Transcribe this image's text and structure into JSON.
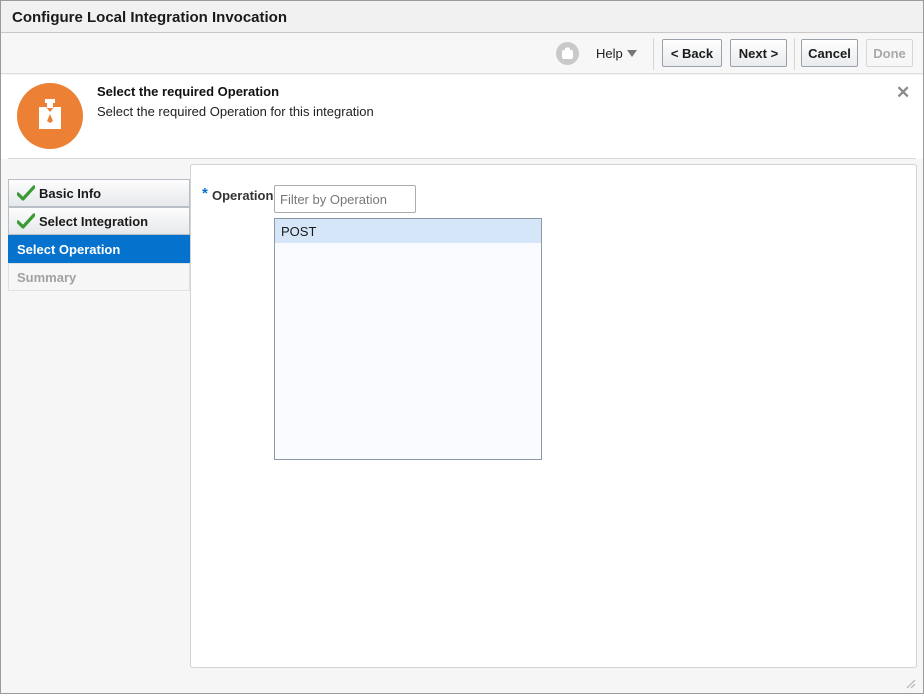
{
  "dialog": {
    "title": "Configure Local Integration Invocation"
  },
  "toolbar": {
    "help_label": "Help",
    "back_label": "< Back",
    "next_label": "Next >",
    "cancel_label": "Cancel",
    "done_label": "Done"
  },
  "header": {
    "title": "Select the required Operation",
    "description": "Select the required Operation for this integration",
    "close_glyph": "✕"
  },
  "nav": {
    "items": [
      {
        "label": "Basic Info",
        "state": "completed"
      },
      {
        "label": "Select Integration",
        "state": "completed"
      },
      {
        "label": "Select Operation",
        "state": "active"
      },
      {
        "label": "Summary",
        "state": "inactive"
      }
    ]
  },
  "form": {
    "required_marker": "*",
    "operation_label": "Operation",
    "filter_placeholder": "Filter by Operation",
    "filter_value": "",
    "operations": [
      "POST"
    ],
    "selected_operation": "POST"
  },
  "colors": {
    "accent": "#0572ce",
    "icon_bg": "#ec8136",
    "check": "#3a9a34",
    "selection": "#d4e6f7"
  },
  "icons": {
    "help": "user-avatar-icon",
    "header": "integration-icon",
    "close": "close-icon",
    "completed": "check-icon"
  }
}
